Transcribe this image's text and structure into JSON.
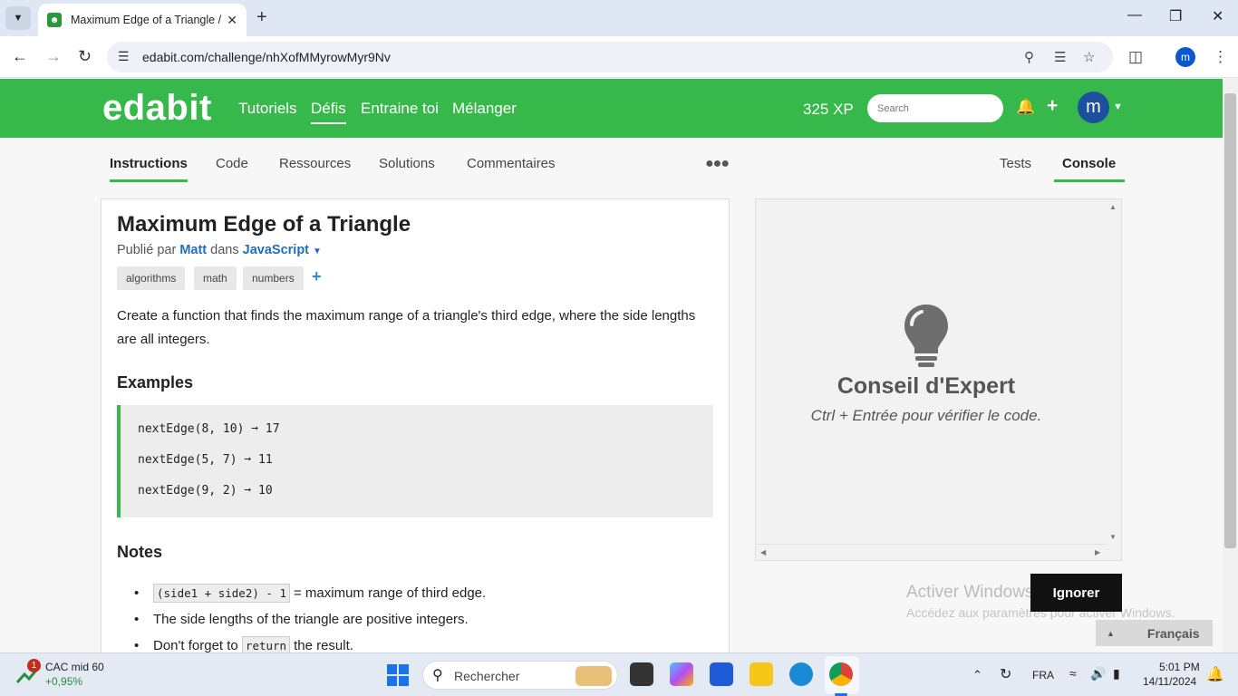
{
  "browser": {
    "tab_title": "Maximum Edge of a Triangle //",
    "url": "edabit.com/challenge/nhXofMMyrowMyr9Nv",
    "profile_initial": "m"
  },
  "header": {
    "logo": "edabit",
    "nav": [
      "Tutoriels",
      "Défis",
      "Entraine toi",
      "Mélanger"
    ],
    "xp": "325 XP",
    "search_placeholder": "Search",
    "avatar_initial": "m"
  },
  "left_tabs": [
    "Instructions",
    "Code",
    "Ressources",
    "Solutions",
    "Commentaires"
  ],
  "right_tabs": [
    "Tests",
    "Console"
  ],
  "challenge": {
    "title": "Maximum Edge of a Triangle",
    "published_prefix": "Publié par",
    "author": "Matt",
    "in": "dans",
    "language": "JavaScript",
    "tags": [
      "algorithms",
      "math",
      "numbers"
    ],
    "description": "Create a function that finds the maximum range of a triangle's third edge, where the side lengths are all integers.",
    "examples_heading": "Examples",
    "examples": [
      "nextEdge(8, 10) ➞ 17",
      "nextEdge(5, 7) ➞ 11",
      "nextEdge(9, 2) ➞ 10"
    ],
    "notes_heading": "Notes",
    "notes": [
      {
        "code": "(side1 + side2) - 1",
        "text": "= maximum range of third edge."
      },
      {
        "text": "The side lengths of the triangle are positive integers."
      },
      {
        "pre": "Don't forget to",
        "code": "return",
        "text": "the result."
      }
    ]
  },
  "console": {
    "tip_title": "Conseil d'Expert",
    "tip_sub": "Ctrl + Entrée pour vérifier le code."
  },
  "overlay": {
    "watermark_title": "Activer Windows",
    "watermark_sub": "Accédez aux paramètres pour activer Windows.",
    "ignore": "Ignorer",
    "language": "Français"
  },
  "taskbar": {
    "stock_name": "CAC mid 60",
    "stock_change": "+0,95%",
    "stock_badge": "1",
    "search": "Rechercher",
    "lang": "FRA",
    "time": "5:01 PM",
    "date": "14/11/2024"
  }
}
